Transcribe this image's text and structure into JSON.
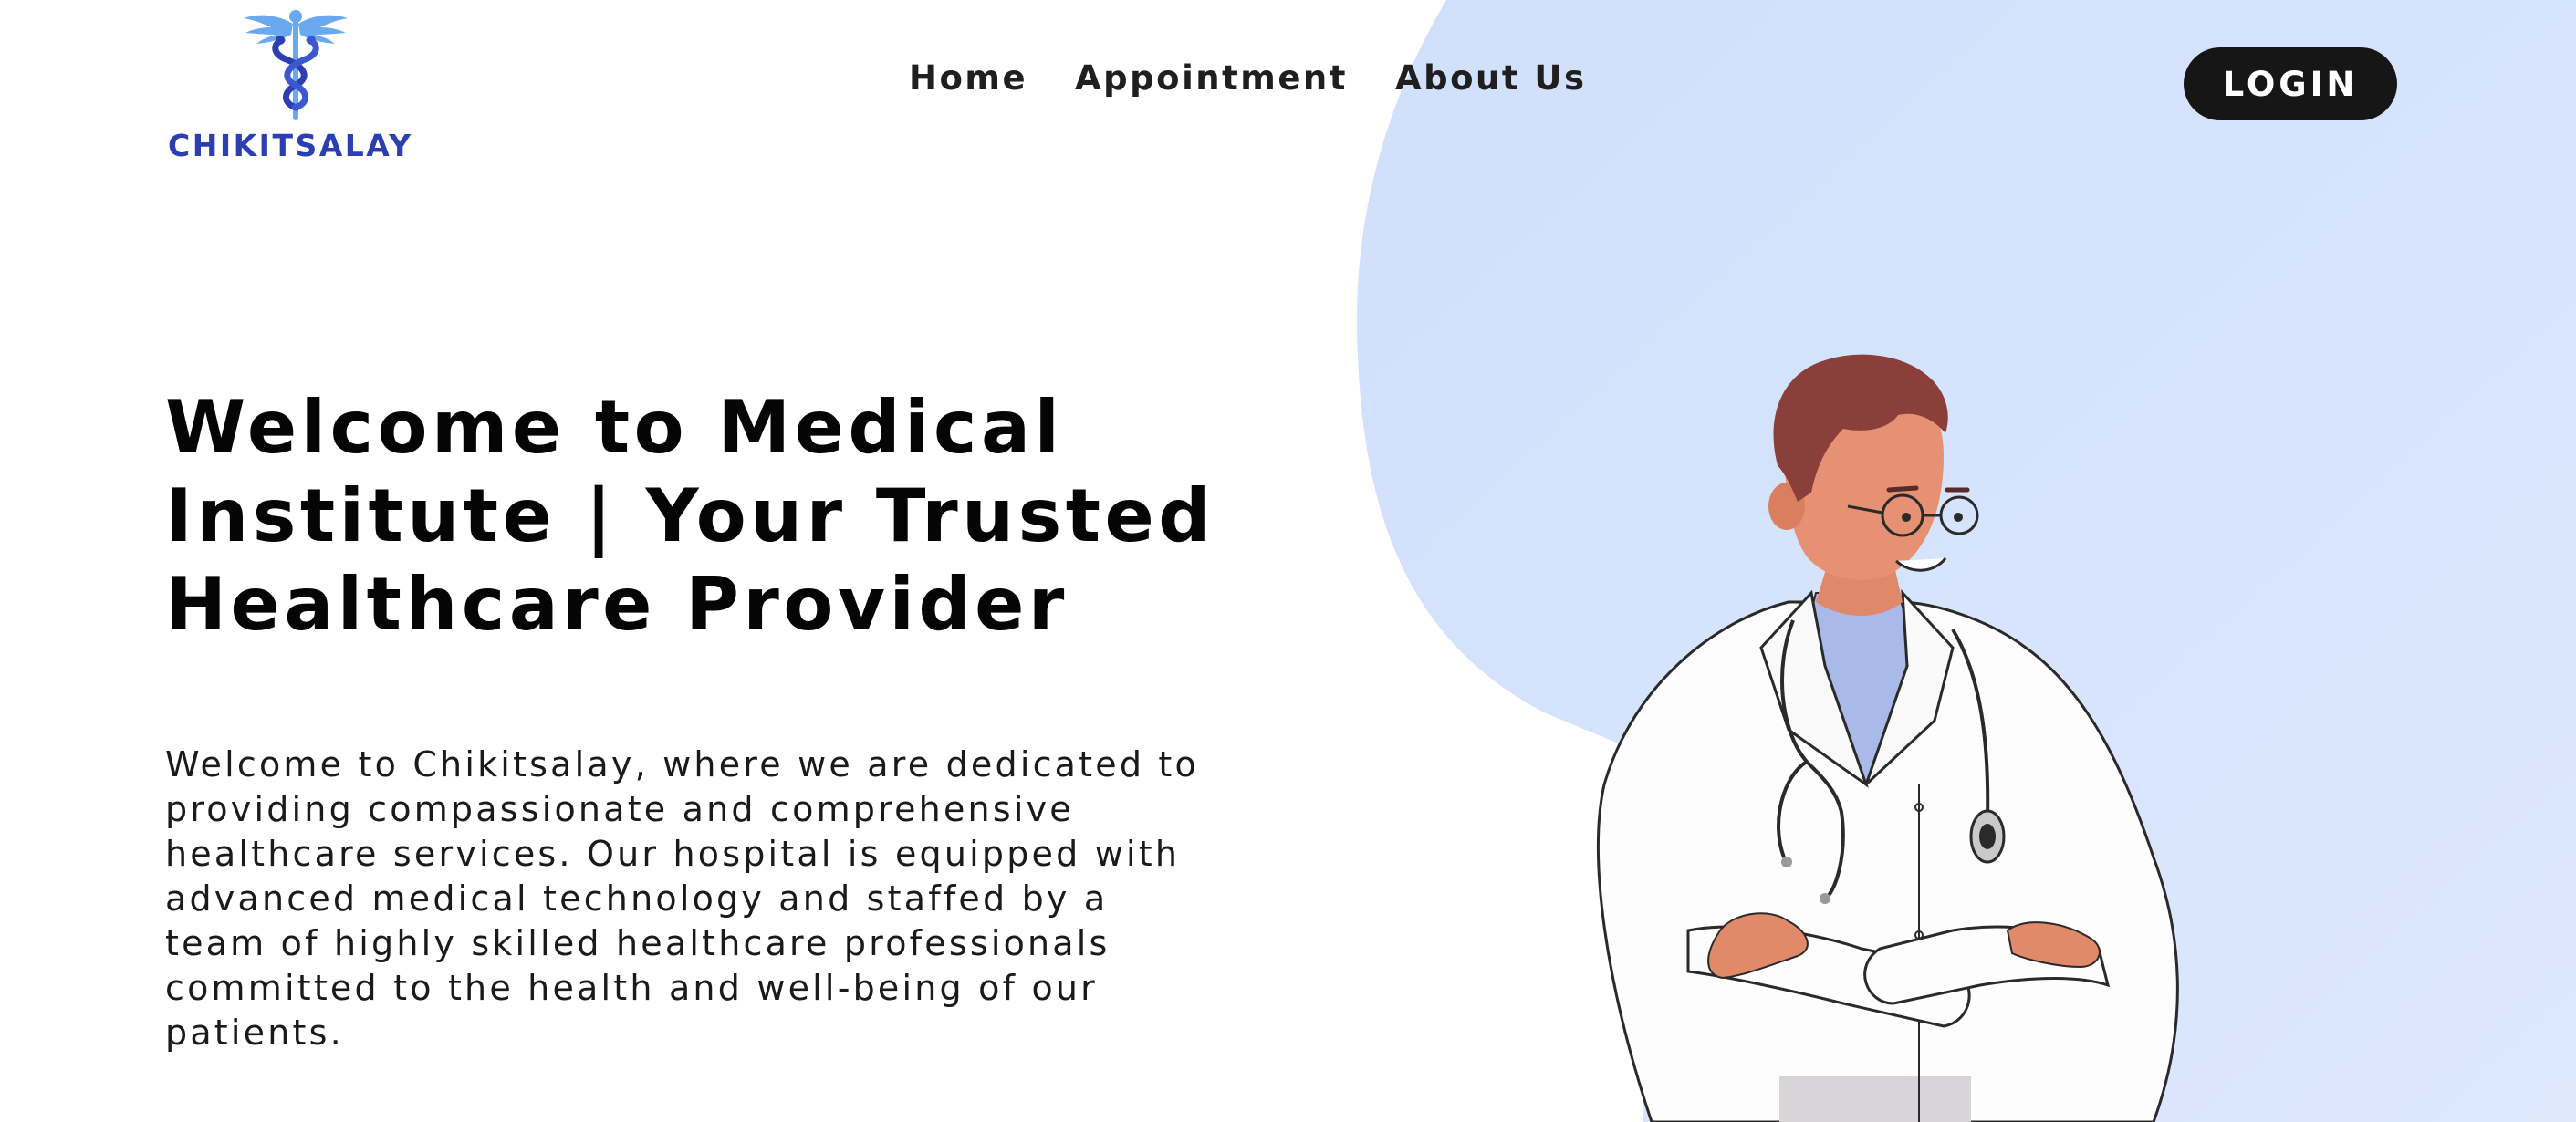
{
  "brand": {
    "name": "CHIKITSALAY",
    "logo_icon": "caduceus-icon"
  },
  "nav": {
    "items": [
      {
        "label": "Home"
      },
      {
        "label": "Appointment"
      },
      {
        "label": "About Us"
      }
    ]
  },
  "header": {
    "login_label": "LOGIN"
  },
  "hero": {
    "title": "Welcome to Medical Institute | Your Trusted Healthcare Provider",
    "description": "Welcome to Chikitsalay, where we are dedicated to providing compassionate and comprehensive healthcare services. Our hospital is equipped with advanced medical technology and staffed by a team of highly skilled healthcare professionals committed to the health and well-being of our patients.",
    "illustration": "doctor-illustration"
  },
  "colors": {
    "brand_blue": "#2b3fb3",
    "logo_light_blue": "#6aa8f0",
    "background_blob": "#d4e2fc",
    "login_button": "#161616",
    "text_dark": "#050505"
  }
}
